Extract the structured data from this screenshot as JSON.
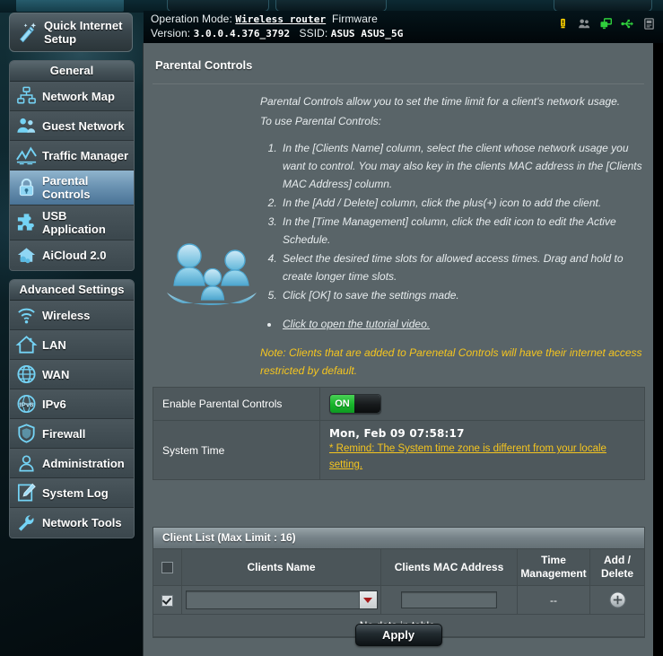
{
  "header": {
    "operation_mode_label": "Operation Mode:",
    "operation_mode_value": "Wireless router",
    "firmware_label": "Firmware",
    "version_label": "Version:",
    "version_value": "3.0.0.4.376_3792",
    "ssid_label": "SSID:",
    "ssid_value": "ASUS ASUS_5G",
    "icons": [
      {
        "name": "alert-icon",
        "color": "#ffd400"
      },
      {
        "name": "clients-group-icon",
        "color": "#8a8f92"
      },
      {
        "name": "network-monitors-icon",
        "color": "#2fcf3c"
      },
      {
        "name": "usb-icon",
        "color": "#2fcf3c"
      },
      {
        "name": "printer-icon",
        "color": "#8a8f92"
      }
    ]
  },
  "sidebar": {
    "quick_setup": {
      "label": "Quick Internet Setup",
      "icon": "magic-wand-icon"
    },
    "general": {
      "title": "General",
      "items": [
        {
          "label": "Network Map",
          "icon": "network-map-icon",
          "active": false
        },
        {
          "label": "Guest Network",
          "icon": "guest-network-icon",
          "active": false
        },
        {
          "label": "Traffic Manager",
          "icon": "traffic-chart-icon",
          "active": false
        },
        {
          "label": "Parental Controls",
          "icon": "lock-icon",
          "active": true
        },
        {
          "label": "USB Application",
          "icon": "puzzle-icon",
          "active": false
        },
        {
          "label": "AiCloud 2.0",
          "icon": "cloud-home-icon",
          "active": false
        }
      ]
    },
    "advanced": {
      "title": "Advanced Settings",
      "items": [
        {
          "label": "Wireless",
          "icon": "wifi-icon",
          "active": false
        },
        {
          "label": "LAN",
          "icon": "house-icon",
          "active": false
        },
        {
          "label": "WAN",
          "icon": "globe-icon",
          "active": false
        },
        {
          "label": "IPv6",
          "icon": "ipv6-globe-icon",
          "active": false
        },
        {
          "label": "Firewall",
          "icon": "shield-icon",
          "active": false
        },
        {
          "label": "Administration",
          "icon": "person-icon",
          "active": false
        },
        {
          "label": "System Log",
          "icon": "log-pencil-icon",
          "active": false
        },
        {
          "label": "Network Tools",
          "icon": "wrench-icon",
          "active": false
        }
      ]
    }
  },
  "main": {
    "page_title": "Parental Controls",
    "illustration": "family-illustration",
    "intro_line1": "Parental Controls allow you to set the time limit for a client's network usage.",
    "intro_line2": "To use Parental Controls:",
    "steps": [
      "In the [Clients Name] column, select the client whose network usage you want to control. You may also key in the clients MAC address in the [Clients MAC Address] column.",
      "In the [Add / Delete] column, click the plus(+) icon to add the client.",
      "In the [Time Management] column, click the edit icon to edit the Active Schedule.",
      "Select the desired time slots for allowed access times. Drag and hold to create longer time slots.",
      "Click [OK] to save the settings made."
    ],
    "tutorial_link": "Click to open the tutorial video.",
    "note": "Note: Clients that are added to Parenetal Controls will have their internet access restricted by default.",
    "note_color": "#f5c51f"
  },
  "settings": {
    "enable_label": "Enable Parental Controls",
    "enable_state": "ON",
    "system_time_label": "System Time",
    "system_time_value": "Mon, Feb 09  07:58:17",
    "time_remind": "* Remind: The System time zone is different from your locale setting."
  },
  "client_list": {
    "title": "Client List (Max Limit : 16)",
    "columns": [
      "",
      "Clients Name",
      "Clients MAC Address",
      "Time Management",
      "Add / Delete"
    ],
    "row": {
      "checked": true,
      "client_name_value": "",
      "mac_value": "",
      "mac_placeholder": "",
      "time_management": "--",
      "add_icon": "plus-circle-icon"
    },
    "empty_message": "No data in table.",
    "empty_color": "#f5c51f"
  },
  "footer": {
    "apply_label": "Apply"
  }
}
